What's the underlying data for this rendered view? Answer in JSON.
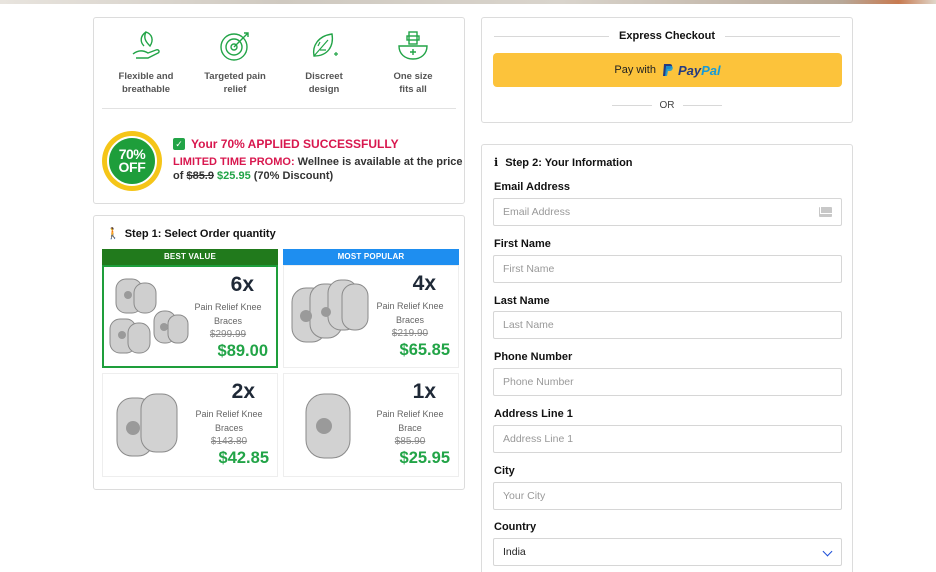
{
  "features": [
    {
      "icon": "hand-leaf-icon",
      "label_line1": "Flexible and",
      "label_line2": "breathable"
    },
    {
      "icon": "target-icon",
      "label_line1": "Targeted pain",
      "label_line2": "relief"
    },
    {
      "icon": "leaf-discreet-icon",
      "label_line1": "Discreet",
      "label_line2": "design"
    },
    {
      "icon": "mortar-cross-icon",
      "label_line1": "One size",
      "label_line2": "fits all"
    }
  ],
  "badge": {
    "line1": "70%",
    "line2": "OFF"
  },
  "promo": {
    "applied": "Your 70% APPLIED SUCCESSFULLY",
    "highlight": "LIMITED TIME PROMO:",
    "text_a": " Wellnee is available at the price of ",
    "old_price": "$85.9",
    "new_price": "$25.95",
    "text_b": " (70% Discount)"
  },
  "step1": {
    "title": "Step 1: Select Order quantity",
    "packages": [
      {
        "banner": "BEST VALUE",
        "qty": "6x",
        "name": "Pain Relief Knee Braces",
        "old": "$299.99",
        "price": "$89.00",
        "selected": true
      },
      {
        "banner": "MOST POPULAR",
        "qty": "4x",
        "name": "Pain Relief Knee Braces",
        "old": "$219.90",
        "price": "$65.85",
        "selected": false
      },
      {
        "banner": "",
        "qty": "2x",
        "name": "Pain Relief Knee Braces",
        "old": "$143.80",
        "price": "$42.85",
        "selected": false
      },
      {
        "banner": "",
        "qty": "1x",
        "name": "Pain Relief Knee Brace",
        "old": "$85.90",
        "price": "$25.95",
        "selected": false
      }
    ]
  },
  "express": {
    "title": "Express Checkout",
    "paypal_prefix": "Pay with",
    "paypal_a": "Pay",
    "paypal_b": "Pal",
    "or": "OR"
  },
  "step2": {
    "title": "Step 2: Your Information",
    "fields": {
      "email": {
        "label": "Email Address",
        "placeholder": "Email Address"
      },
      "first": {
        "label": "First Name",
        "placeholder": "First Name"
      },
      "last": {
        "label": "Last Name",
        "placeholder": "Last Name"
      },
      "phone": {
        "label": "Phone Number",
        "placeholder": "Phone Number"
      },
      "address": {
        "label": "Address Line 1",
        "placeholder": "Address Line 1"
      },
      "city": {
        "label": "City",
        "placeholder": "Your City"
      },
      "country": {
        "label": "Country",
        "value": "India"
      }
    }
  },
  "colors": {
    "accent_green": "#22a447",
    "promo_red": "#d8174e",
    "paypal_yellow": "#fcc33b",
    "banner_green": "#217a1c",
    "banner_blue": "#1e8ef0"
  }
}
